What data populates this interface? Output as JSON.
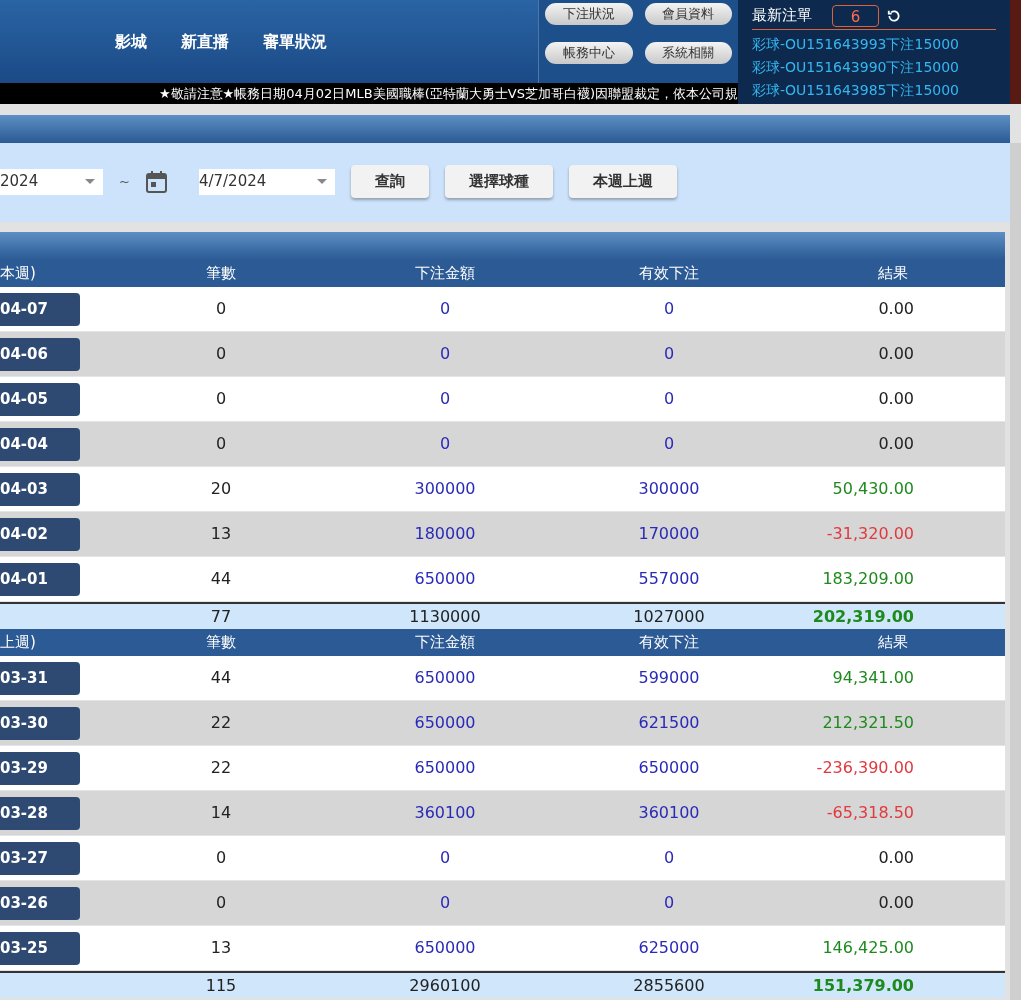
{
  "nav": [
    "影城",
    "新直播",
    "審單狀況"
  ],
  "header_buttons": [
    "下注狀況",
    "會員資料",
    "帳務中心",
    "系統相關"
  ],
  "latest": {
    "title": "最新注單",
    "count": "6",
    "items": [
      "彩球-OU151643993下注15000",
      "彩球-OU151643990下注15000",
      "彩球-OU151643985下注15000"
    ]
  },
  "ticker": "★敬請注意★帳務日期04月02日MLB美國職棒(亞特蘭大勇士VS芝加哥白襪)因聯盟裁定，依本公司規",
  "filter": {
    "start": "2024",
    "separator": "~",
    "end": "4/7/2024",
    "buttons": [
      "查詢",
      "選擇球種",
      "本週上週"
    ]
  },
  "weeks": [
    {
      "columns": [
        "本週)",
        "筆數",
        "下注金額",
        "有效下注",
        "結果"
      ],
      "rows": [
        {
          "date": "04-07",
          "count": "0",
          "bet": "0",
          "valid": "0",
          "result": "0.00",
          "color": "#222222"
        },
        {
          "date": "04-06",
          "count": "0",
          "bet": "0",
          "valid": "0",
          "result": "0.00",
          "color": "#222222"
        },
        {
          "date": "04-05",
          "count": "0",
          "bet": "0",
          "valid": "0",
          "result": "0.00",
          "color": "#222222"
        },
        {
          "date": "04-04",
          "count": "0",
          "bet": "0",
          "valid": "0",
          "result": "0.00",
          "color": "#222222"
        },
        {
          "date": "04-03",
          "count": "20",
          "bet": "300000",
          "valid": "300000",
          "result": "50,430.00",
          "color": "#1e8a1e"
        },
        {
          "date": "04-02",
          "count": "13",
          "bet": "180000",
          "valid": "170000",
          "result": "-31,320.00",
          "color": "#e0393e"
        },
        {
          "date": "04-01",
          "count": "44",
          "bet": "650000",
          "valid": "557000",
          "result": "183,209.00",
          "color": "#1e8a1e"
        }
      ],
      "total": {
        "count": "77",
        "bet": "1130000",
        "valid": "1027000",
        "result": "202,319.00"
      }
    },
    {
      "columns": [
        "上週)",
        "筆數",
        "下注金額",
        "有效下注",
        "結果"
      ],
      "rows": [
        {
          "date": "03-31",
          "count": "44",
          "bet": "650000",
          "valid": "599000",
          "result": "94,341.00",
          "color": "#1e8a1e"
        },
        {
          "date": "03-30",
          "count": "22",
          "bet": "650000",
          "valid": "621500",
          "result": "212,321.50",
          "color": "#1e8a1e"
        },
        {
          "date": "03-29",
          "count": "22",
          "bet": "650000",
          "valid": "650000",
          "result": "-236,390.00",
          "color": "#e0393e"
        },
        {
          "date": "03-28",
          "count": "14",
          "bet": "360100",
          "valid": "360100",
          "result": "-65,318.50",
          "color": "#e0393e"
        },
        {
          "date": "03-27",
          "count": "0",
          "bet": "0",
          "valid": "0",
          "result": "0.00",
          "color": "#222222"
        },
        {
          "date": "03-26",
          "count": "0",
          "bet": "0",
          "valid": "0",
          "result": "0.00",
          "color": "#222222"
        },
        {
          "date": "03-25",
          "count": "13",
          "bet": "650000",
          "valid": "625000",
          "result": "146,425.00",
          "color": "#1e8a1e"
        }
      ],
      "total": {
        "count": "115",
        "bet": "2960100",
        "valid": "2855600",
        "result": "151,379.00"
      }
    }
  ]
}
